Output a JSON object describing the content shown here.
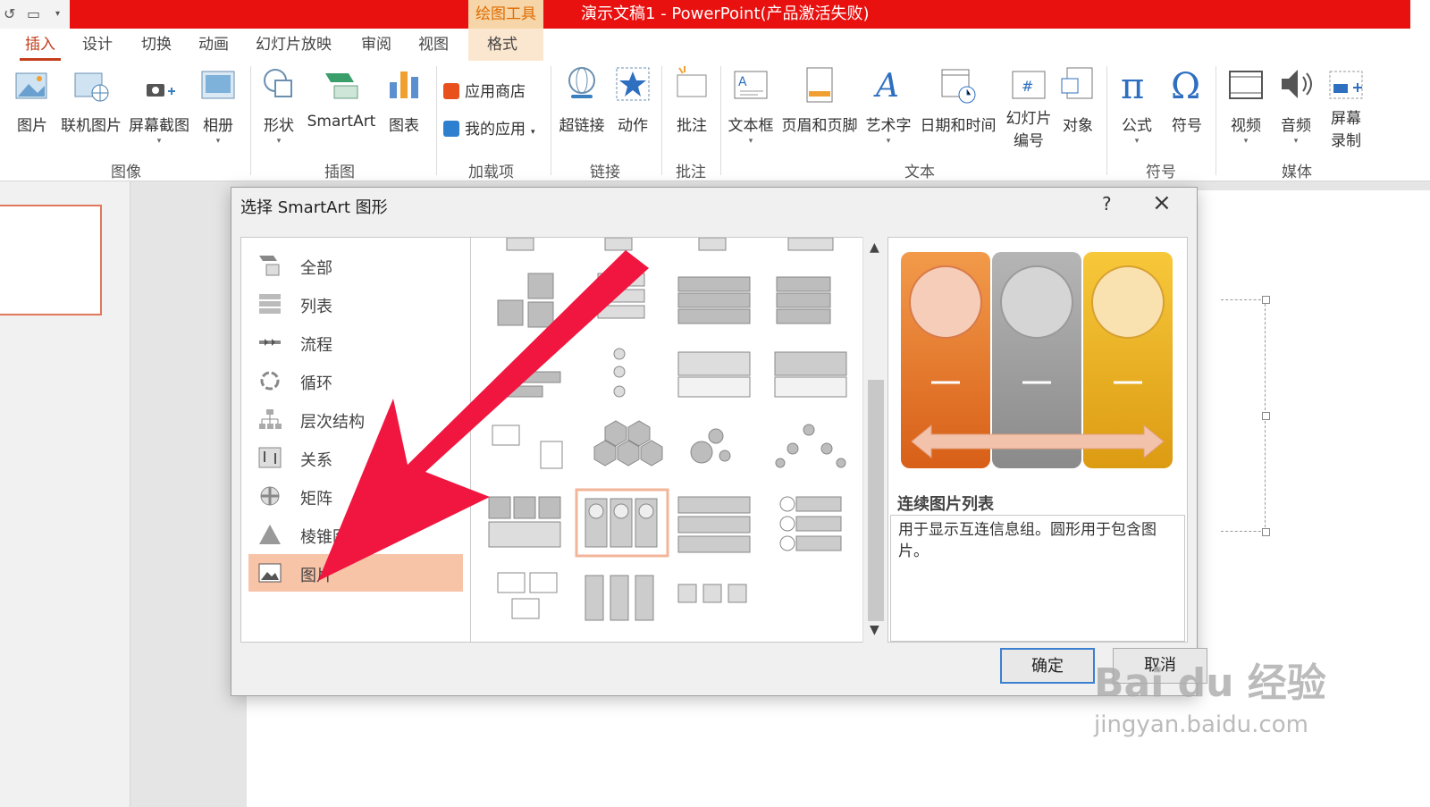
{
  "titlebar": {
    "context_tab": "绘图工具",
    "document_title": "演示文稿1 - PowerPoint(产品激活失败)"
  },
  "tabs": [
    {
      "label": "插入",
      "active": true
    },
    {
      "label": "设计"
    },
    {
      "label": "切换"
    },
    {
      "label": "动画"
    },
    {
      "label": "幻灯片放映"
    },
    {
      "label": "审阅"
    },
    {
      "label": "视图"
    },
    {
      "label": "格式"
    }
  ],
  "ribbon": {
    "buttons": {
      "picture": "图片",
      "online_picture": "联机图片",
      "screenshot": "屏幕截图",
      "album": "相册",
      "shapes": "形状",
      "smartart": "SmartArt",
      "chart": "图表",
      "store": "应用商店",
      "my_apps": "我的应用",
      "hyperlink": "超链接",
      "action": "动作",
      "comment": "批注",
      "textbox": "文本框",
      "header_footer": "页眉和页脚",
      "wordart": "艺术字",
      "datetime": "日期和时间",
      "slide_number_1": "幻灯片",
      "slide_number_2": "编号",
      "object": "对象",
      "equation": "公式",
      "symbol": "符号",
      "video": "视频",
      "audio": "音频",
      "screen_recording_1": "屏幕",
      "screen_recording_2": "录制"
    },
    "groups": {
      "images": "图像",
      "illustrations": "插图",
      "addins": "加载项",
      "links": "链接",
      "comments": "批注",
      "text": "文本",
      "symbols": "符号",
      "media": "媒体"
    }
  },
  "dialog": {
    "title": "选择 SmartArt 图形",
    "help": "?",
    "categories": [
      {
        "label": "全部",
        "icon": "all-icon"
      },
      {
        "label": "列表",
        "icon": "list-icon"
      },
      {
        "label": "流程",
        "icon": "process-icon"
      },
      {
        "label": "循环",
        "icon": "cycle-icon"
      },
      {
        "label": "层次结构",
        "icon": "hierarchy-icon"
      },
      {
        "label": "关系",
        "icon": "relationship-icon"
      },
      {
        "label": "矩阵",
        "icon": "matrix-icon"
      },
      {
        "label": "棱锥图",
        "icon": "pyramid-icon"
      },
      {
        "label": "图片",
        "icon": "picture-icon",
        "selected": true
      }
    ],
    "preview_title": "连续图片列表",
    "preview_description": "用于显示互连信息组。圆形用于包含图片。",
    "ok_label": "确定",
    "cancel_label": "取消",
    "preview_colors": [
      "#e8742a",
      "#9c9c9c",
      "#f1b51c"
    ]
  },
  "watermark": {
    "brand": "Bai du 经验",
    "url": "jingyan.baidu.com"
  }
}
